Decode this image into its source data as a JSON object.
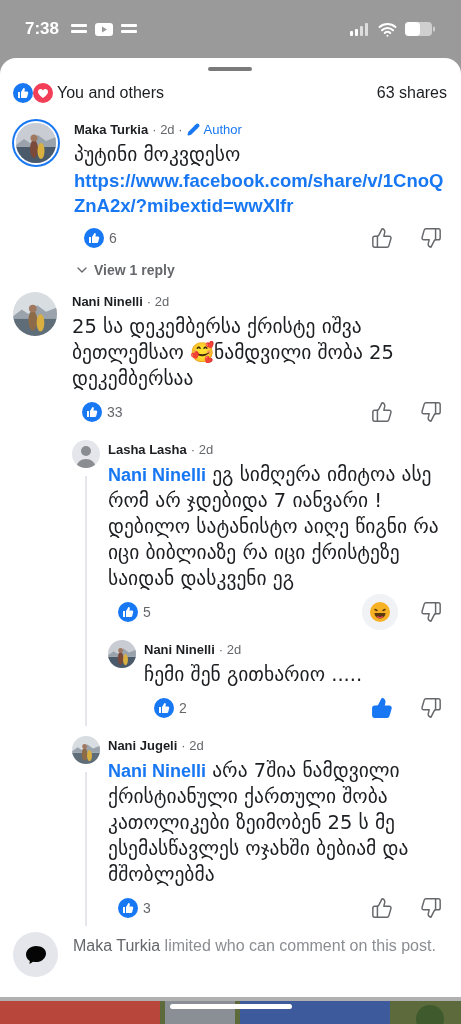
{
  "status_bar": {
    "time": "7:38"
  },
  "summary": {
    "reactions_text": "You and others",
    "shares": "63 shares"
  },
  "comments": [
    {
      "author": "Maka Turkia",
      "time": "· 2d ·",
      "badge": "Author",
      "story_ring": true,
      "default_avatar": false,
      "text": "პუტინი მოკვდესო",
      "link": "https://www.facebook.com/share/v/1CnoQZnA2x/?mibextid=wwXIfr",
      "likes": "6",
      "liked": false,
      "haha": false,
      "view_replies": "View 1 reply"
    },
    {
      "author": "Nani Ninelli",
      "time": "· 2d",
      "story_ring": false,
      "default_avatar": false,
      "text": "25 სა დეკემბერსა ქრისტე იშვა ბეთლემსაო  🥰ნამდვილი შობა 25 დეკემბერსაა",
      "likes": "33",
      "liked": false,
      "haha": false,
      "replies": [
        {
          "author": "Lasha Lasha",
          "time": "· 2d",
          "story_ring": false,
          "default_avatar": true,
          "mention": "Nani Ninelli",
          "text": "ეგ სიმღერა იმიტოა ასე რომ არ ჯდებიდა 7 იანვარი ! დებილო სატანისტო აიღე წიგნი რა იცი ბიბლიაზე რა იცი ქრისტეზე საიდან დასკვენი ეგ",
          "likes": "5",
          "haha": true,
          "replies": [
            {
              "author": "Nani Ninelli",
              "time": "· 2d",
              "story_ring": false,
              "default_avatar": false,
              "text": "ჩემი შენ გითხარიო .....",
              "likes": "2",
              "liked": true,
              "haha": false
            }
          ]
        },
        {
          "author": "Nani Jugeli",
          "time": "· 2d",
          "story_ring": false,
          "default_avatar": false,
          "mention": "Nani Ninelli",
          "text": "არა 7შია ნამდვილი ქრისტიანული ქართული შობა კათოლიკები ზეიმობენ 25 ს მე ესემასწავლეს ოჯახში ბებიამ და მშობლებმა",
          "likes": "3",
          "liked": false,
          "haha": false
        }
      ]
    }
  ],
  "notice": {
    "name": "Maka Turkia",
    "text": "limited who can comment on this post."
  }
}
